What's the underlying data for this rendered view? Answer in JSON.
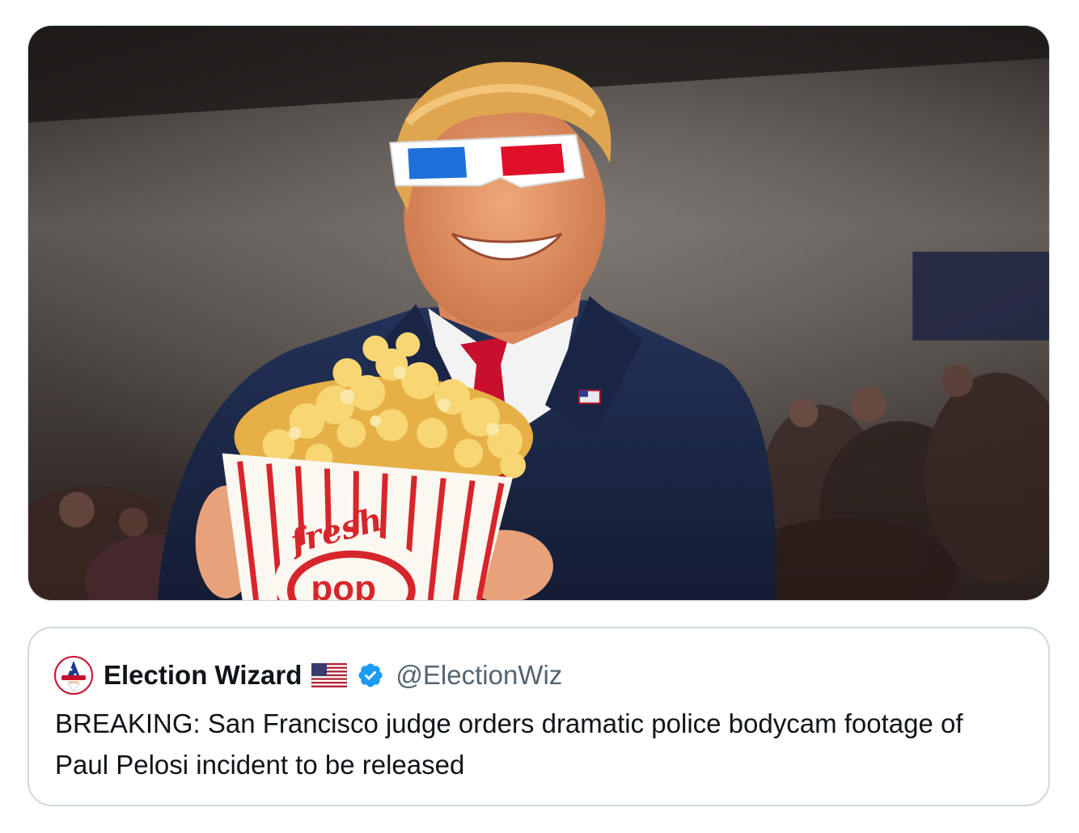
{
  "media": {
    "popcorn_box_text": [
      "fresh",
      "pop"
    ],
    "colors": {
      "background_dark": "#3a3836",
      "suit": "#1f2b4a",
      "tie": "#c8102e",
      "glasses_left": "#1e6fd9",
      "glasses_right": "#e0102a",
      "popcorn": "#f2c14e",
      "box_stripe": "#d7262b"
    }
  },
  "quoted_tweet": {
    "avatar_icon": "wizard-avatar-icon",
    "display_name": "Election Wizard",
    "flag_icon": "us-flag-icon",
    "verified_icon": "verified-badge-icon",
    "handle": "@ElectionWiz",
    "text": "BREAKING: San Francisco judge orders dramatic police bodycam footage of Paul Pelosi incident to be released",
    "colors": {
      "verified": "#1d9bf0",
      "name": "#0f1419",
      "handle": "#536471",
      "border": "#cfd9de"
    }
  }
}
